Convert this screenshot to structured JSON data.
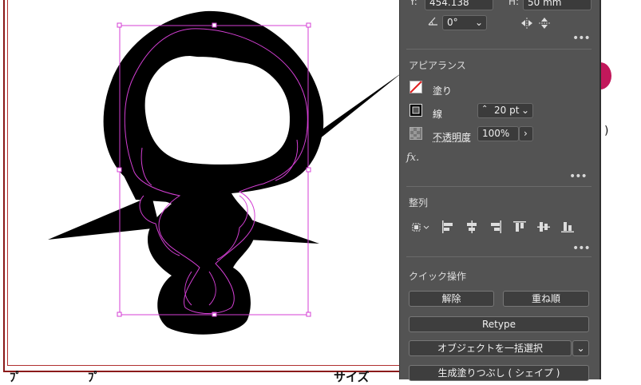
{
  "transform": {
    "y_label": "Y:",
    "y_value": "454.138",
    "h_label": "H:",
    "h_value": "50 mm",
    "angle_value": "0°",
    "icons": [
      "angle-icon",
      "flip-horizontal-icon",
      "flip-vertical-icon"
    ]
  },
  "appearance": {
    "title": "アピアランス",
    "fill_label": "塗り",
    "stroke_label": "線",
    "stroke_weight": "20 pt",
    "opacity_label": "不透明度",
    "opacity_value": "100%",
    "fx_label": "fx."
  },
  "align": {
    "title": "整列",
    "icons": [
      "align-to-icon",
      "align-left-icon",
      "align-hcenter-icon",
      "align-right-icon",
      "align-top-icon",
      "align-vcenter-icon",
      "align-bottom-icon"
    ]
  },
  "quick_actions": {
    "title": "クイック操作",
    "release_label": "解除",
    "arrange_label": "重ね順",
    "retype_label": "Retype",
    "select_same_label": "オブジェクトを一括選択",
    "generative_fill_label": "生成塗りつぶし ( シェイプ )"
  },
  "canvas": {
    "bottom_text_left": "ﾌﾟ",
    "bottom_text_mid": "ﾌﾟ",
    "bottom_text_right": "サイズ",
    "side_text": ")",
    "colors": {
      "artwork_fill": "#000000",
      "selection": "#d43fd4",
      "artboard_border": "#8b1a1a",
      "panel_bg": "#535353",
      "magenta_swatch": "#c2185b"
    }
  }
}
